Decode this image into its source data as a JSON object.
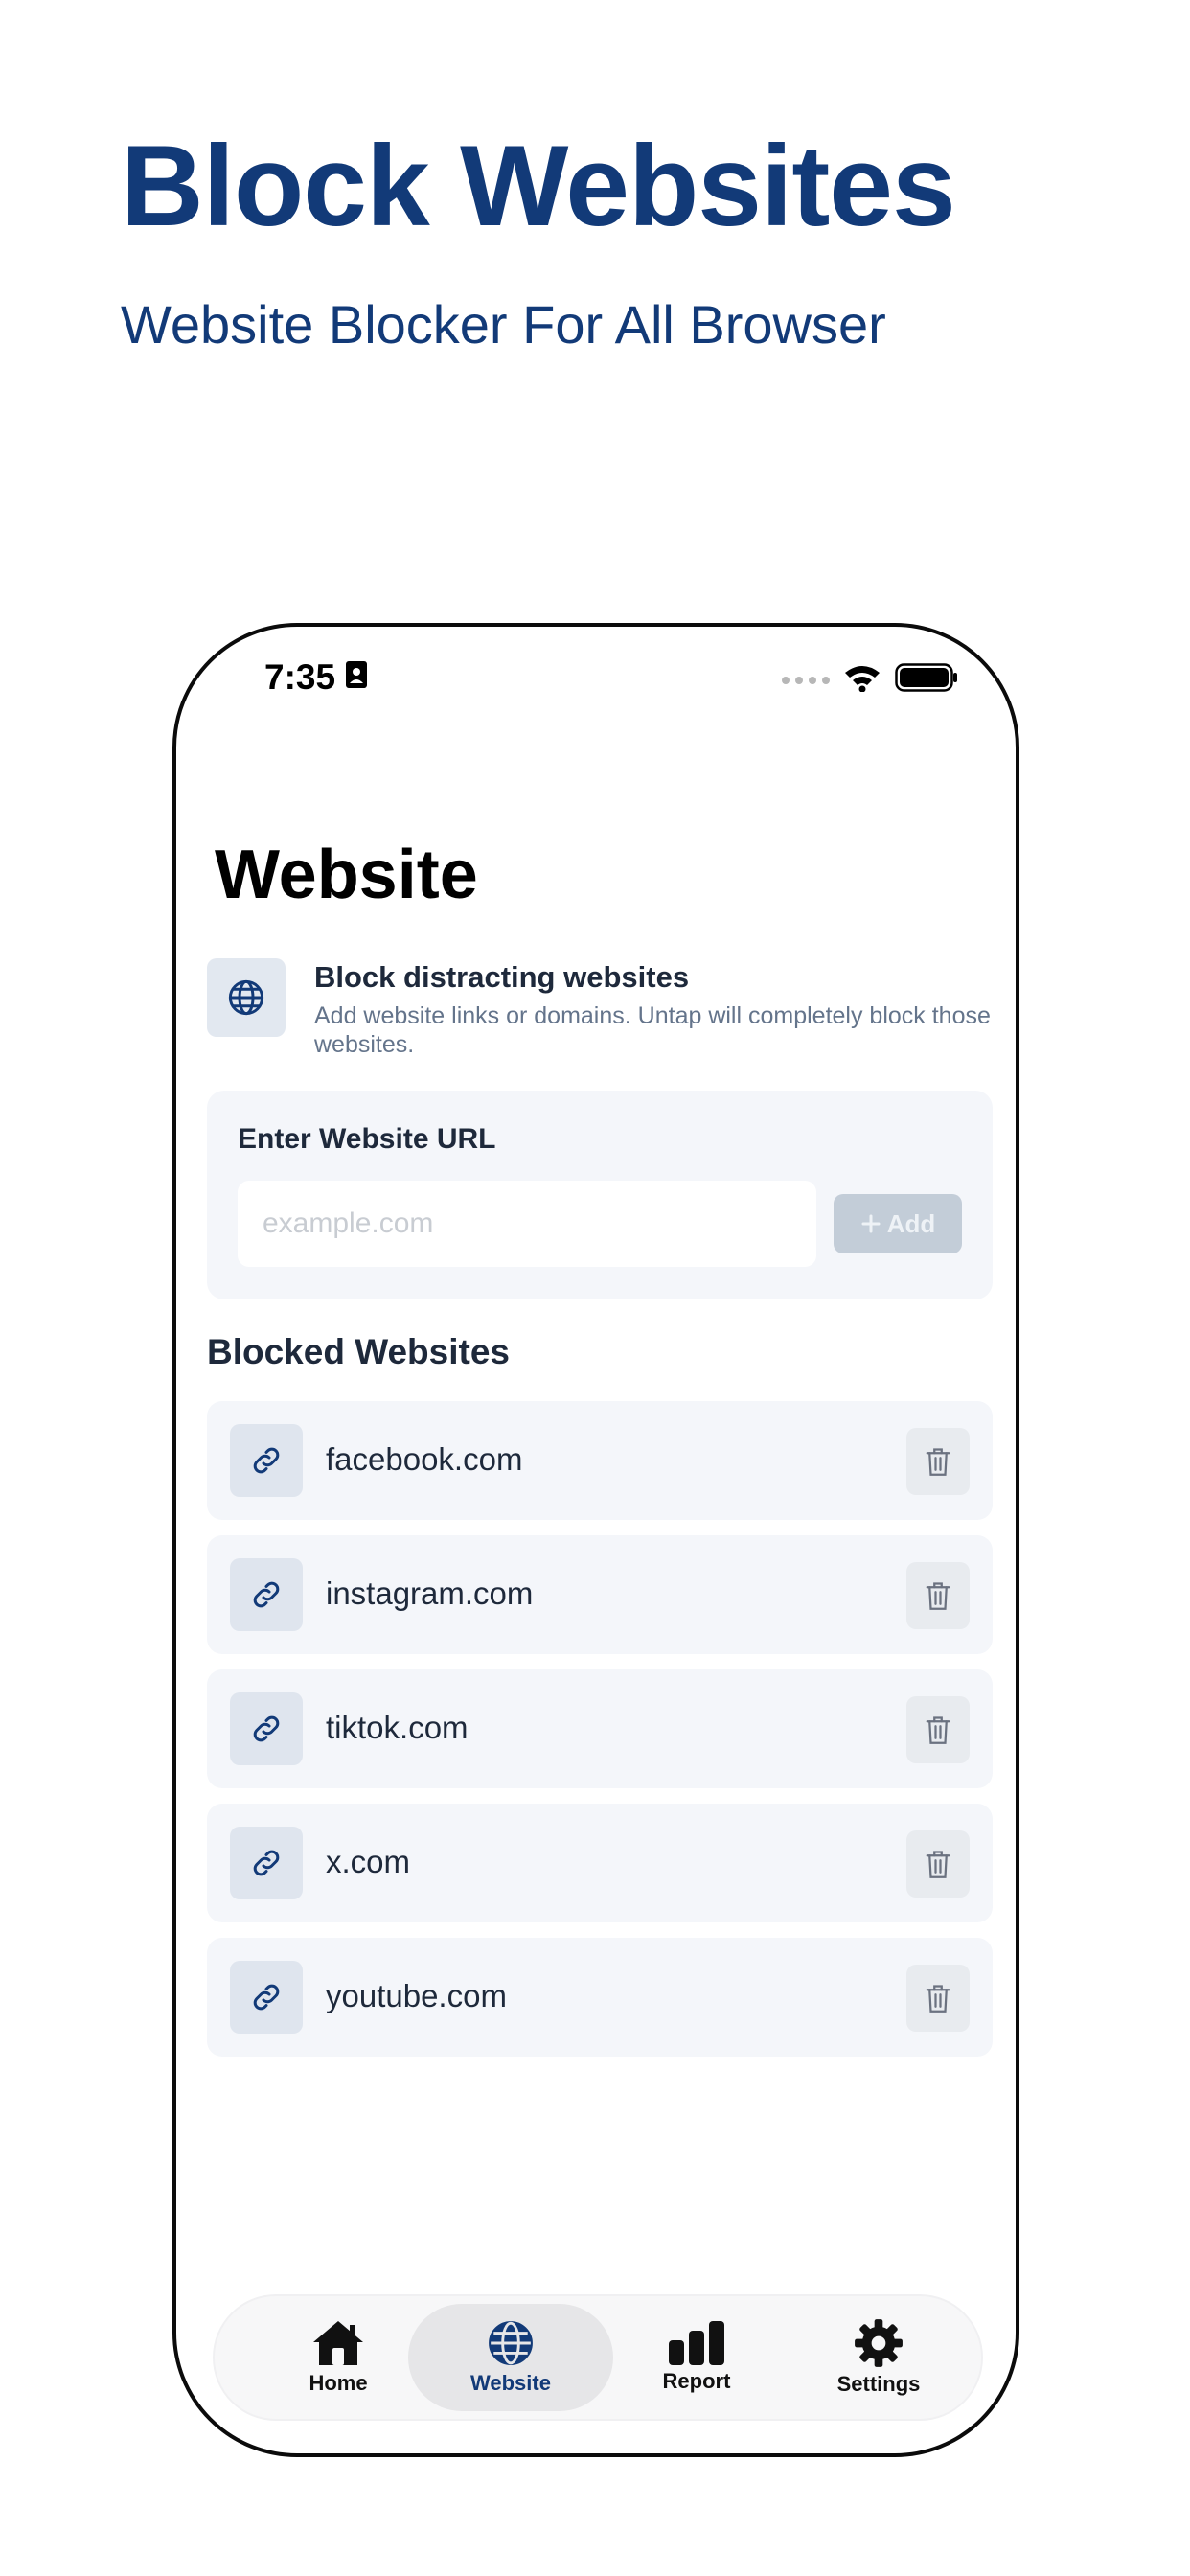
{
  "hero": {
    "title": "Block Websites",
    "subtitle": "Website Blocker For All Browser"
  },
  "status_bar": {
    "time": "7:35"
  },
  "page": {
    "title": "Website"
  },
  "intro": {
    "icon": "globe-icon",
    "title": "Block distracting websites",
    "description": "Add website links or domains. Untap will completely block those websites."
  },
  "url_card": {
    "label": "Enter Website URL",
    "input_value": "",
    "input_placeholder": "example.com",
    "add_label": "Add"
  },
  "blocked": {
    "title": "Blocked Websites",
    "sites": [
      {
        "name": "facebook.com"
      },
      {
        "name": "instagram.com"
      },
      {
        "name": "tiktok.com"
      },
      {
        "name": "x.com"
      },
      {
        "name": "youtube.com"
      }
    ]
  },
  "tabbar": {
    "tabs": [
      {
        "label": "Home",
        "icon": "home-icon"
      },
      {
        "label": "Website",
        "icon": "globe-icon",
        "active": true
      },
      {
        "label": "Report",
        "icon": "bar-chart-icon"
      },
      {
        "label": "Settings",
        "icon": "gear-icon"
      }
    ]
  },
  "colors": {
    "brand_navy": "#123a78",
    "card_bg": "#f4f6fa",
    "icon_bg": "#dfe5ee",
    "muted_text": "#64748b",
    "add_disabled": "#c3cdd8"
  }
}
